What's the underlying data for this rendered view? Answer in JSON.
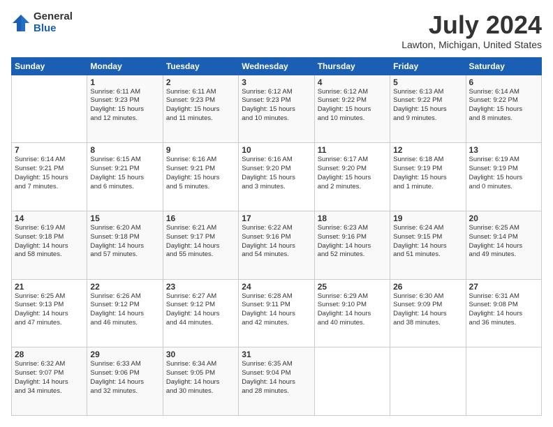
{
  "logo": {
    "general": "General",
    "blue": "Blue"
  },
  "header": {
    "title": "July 2024",
    "subtitle": "Lawton, Michigan, United States"
  },
  "calendar": {
    "days_of_week": [
      "Sunday",
      "Monday",
      "Tuesday",
      "Wednesday",
      "Thursday",
      "Friday",
      "Saturday"
    ],
    "weeks": [
      [
        {
          "day": "",
          "info": ""
        },
        {
          "day": "1",
          "info": "Sunrise: 6:11 AM\nSunset: 9:23 PM\nDaylight: 15 hours\nand 12 minutes."
        },
        {
          "day": "2",
          "info": "Sunrise: 6:11 AM\nSunset: 9:23 PM\nDaylight: 15 hours\nand 11 minutes."
        },
        {
          "day": "3",
          "info": "Sunrise: 6:12 AM\nSunset: 9:23 PM\nDaylight: 15 hours\nand 10 minutes."
        },
        {
          "day": "4",
          "info": "Sunrise: 6:12 AM\nSunset: 9:22 PM\nDaylight: 15 hours\nand 10 minutes."
        },
        {
          "day": "5",
          "info": "Sunrise: 6:13 AM\nSunset: 9:22 PM\nDaylight: 15 hours\nand 9 minutes."
        },
        {
          "day": "6",
          "info": "Sunrise: 6:14 AM\nSunset: 9:22 PM\nDaylight: 15 hours\nand 8 minutes."
        }
      ],
      [
        {
          "day": "7",
          "info": "Sunrise: 6:14 AM\nSunset: 9:21 PM\nDaylight: 15 hours\nand 7 minutes."
        },
        {
          "day": "8",
          "info": "Sunrise: 6:15 AM\nSunset: 9:21 PM\nDaylight: 15 hours\nand 6 minutes."
        },
        {
          "day": "9",
          "info": "Sunrise: 6:16 AM\nSunset: 9:21 PM\nDaylight: 15 hours\nand 5 minutes."
        },
        {
          "day": "10",
          "info": "Sunrise: 6:16 AM\nSunset: 9:20 PM\nDaylight: 15 hours\nand 3 minutes."
        },
        {
          "day": "11",
          "info": "Sunrise: 6:17 AM\nSunset: 9:20 PM\nDaylight: 15 hours\nand 2 minutes."
        },
        {
          "day": "12",
          "info": "Sunrise: 6:18 AM\nSunset: 9:19 PM\nDaylight: 15 hours\nand 1 minute."
        },
        {
          "day": "13",
          "info": "Sunrise: 6:19 AM\nSunset: 9:19 PM\nDaylight: 15 hours\nand 0 minutes."
        }
      ],
      [
        {
          "day": "14",
          "info": "Sunrise: 6:19 AM\nSunset: 9:18 PM\nDaylight: 14 hours\nand 58 minutes."
        },
        {
          "day": "15",
          "info": "Sunrise: 6:20 AM\nSunset: 9:18 PM\nDaylight: 14 hours\nand 57 minutes."
        },
        {
          "day": "16",
          "info": "Sunrise: 6:21 AM\nSunset: 9:17 PM\nDaylight: 14 hours\nand 55 minutes."
        },
        {
          "day": "17",
          "info": "Sunrise: 6:22 AM\nSunset: 9:16 PM\nDaylight: 14 hours\nand 54 minutes."
        },
        {
          "day": "18",
          "info": "Sunrise: 6:23 AM\nSunset: 9:16 PM\nDaylight: 14 hours\nand 52 minutes."
        },
        {
          "day": "19",
          "info": "Sunrise: 6:24 AM\nSunset: 9:15 PM\nDaylight: 14 hours\nand 51 minutes."
        },
        {
          "day": "20",
          "info": "Sunrise: 6:25 AM\nSunset: 9:14 PM\nDaylight: 14 hours\nand 49 minutes."
        }
      ],
      [
        {
          "day": "21",
          "info": "Sunrise: 6:25 AM\nSunset: 9:13 PM\nDaylight: 14 hours\nand 47 minutes."
        },
        {
          "day": "22",
          "info": "Sunrise: 6:26 AM\nSunset: 9:12 PM\nDaylight: 14 hours\nand 46 minutes."
        },
        {
          "day": "23",
          "info": "Sunrise: 6:27 AM\nSunset: 9:12 PM\nDaylight: 14 hours\nand 44 minutes."
        },
        {
          "day": "24",
          "info": "Sunrise: 6:28 AM\nSunset: 9:11 PM\nDaylight: 14 hours\nand 42 minutes."
        },
        {
          "day": "25",
          "info": "Sunrise: 6:29 AM\nSunset: 9:10 PM\nDaylight: 14 hours\nand 40 minutes."
        },
        {
          "day": "26",
          "info": "Sunrise: 6:30 AM\nSunset: 9:09 PM\nDaylight: 14 hours\nand 38 minutes."
        },
        {
          "day": "27",
          "info": "Sunrise: 6:31 AM\nSunset: 9:08 PM\nDaylight: 14 hours\nand 36 minutes."
        }
      ],
      [
        {
          "day": "28",
          "info": "Sunrise: 6:32 AM\nSunset: 9:07 PM\nDaylight: 14 hours\nand 34 minutes."
        },
        {
          "day": "29",
          "info": "Sunrise: 6:33 AM\nSunset: 9:06 PM\nDaylight: 14 hours\nand 32 minutes."
        },
        {
          "day": "30",
          "info": "Sunrise: 6:34 AM\nSunset: 9:05 PM\nDaylight: 14 hours\nand 30 minutes."
        },
        {
          "day": "31",
          "info": "Sunrise: 6:35 AM\nSunset: 9:04 PM\nDaylight: 14 hours\nand 28 minutes."
        },
        {
          "day": "",
          "info": ""
        },
        {
          "day": "",
          "info": ""
        },
        {
          "day": "",
          "info": ""
        }
      ]
    ]
  }
}
